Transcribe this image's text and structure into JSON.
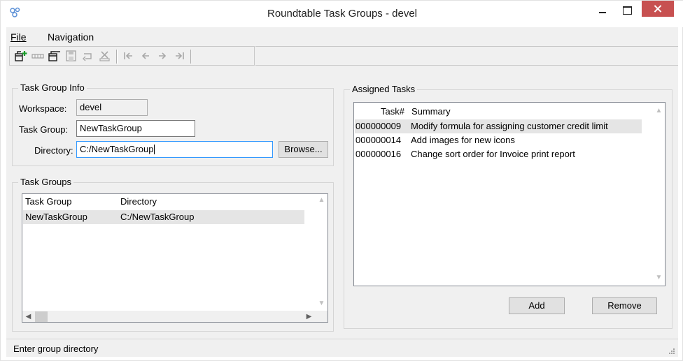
{
  "window": {
    "title": "Roundtable Task Groups - devel"
  },
  "menu": [
    {
      "label": "File"
    },
    {
      "label": "Navigation"
    }
  ],
  "toolbar": {
    "buttons": [
      "add-group-icon",
      "delete-group-icon",
      "edit-group-icon",
      "save-icon",
      "undo-icon",
      "delete-icon"
    ],
    "nav": [
      "first-record-icon",
      "previous-record-icon",
      "next-record-icon",
      "last-record-icon"
    ]
  },
  "task_group_info": {
    "title": "Task Group Info",
    "workspace_label": "Workspace:",
    "workspace_value": "devel",
    "task_group_label": "Task Group:",
    "task_group_value": "NewTaskGroup",
    "directory_label": "Directory:",
    "directory_value": "C:/NewTaskGroup",
    "browse_label": "Browse..."
  },
  "task_groups": {
    "title": "Task Groups",
    "columns": [
      "Task Group",
      "Directory"
    ],
    "rows": [
      {
        "group": "NewTaskGroup",
        "directory": "C:/NewTaskGroup"
      }
    ]
  },
  "assigned_tasks": {
    "title": "Assigned Tasks",
    "columns": [
      "Task#",
      "Summary"
    ],
    "rows": [
      {
        "task": "000000009",
        "summary": "Modify formula for assigning customer credit limit"
      },
      {
        "task": "000000014",
        "summary": "Add images for new icons"
      },
      {
        "task": "000000016",
        "summary": "Change sort order for Invoice print report"
      }
    ],
    "add_label": "Add",
    "remove_label": "Remove"
  },
  "status": {
    "text": "Enter group directory"
  },
  "colors": {
    "close_button": "#c75050",
    "selected_row": "#e5e5e5",
    "focus_border": "#3399ff"
  }
}
